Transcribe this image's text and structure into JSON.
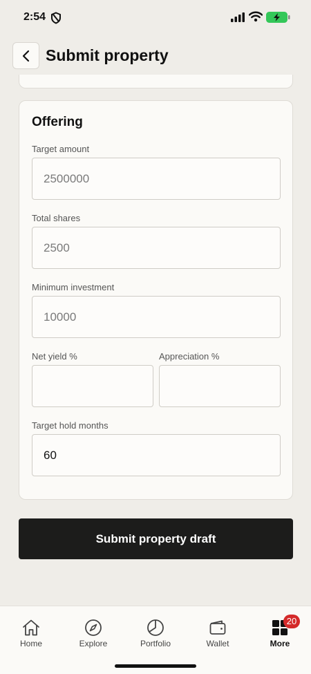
{
  "status_bar": {
    "time": "2:54"
  },
  "header": {
    "title": "Submit property"
  },
  "offering": {
    "title": "Offering",
    "target_amount": {
      "label": "Target amount",
      "placeholder": "2500000",
      "value": ""
    },
    "total_shares": {
      "label": "Total shares",
      "placeholder": "2500",
      "value": ""
    },
    "minimum_investment": {
      "label": "Minimum investment",
      "placeholder": "10000",
      "value": ""
    },
    "net_yield": {
      "label": "Net yield %",
      "placeholder": "",
      "value": ""
    },
    "appreciation": {
      "label": "Appreciation %",
      "placeholder": "",
      "value": ""
    },
    "target_hold_months": {
      "label": "Target hold months",
      "placeholder": "",
      "value": "60"
    }
  },
  "submit_label": "Submit property draft",
  "nav": {
    "items": [
      {
        "label": "Home",
        "icon": "home-icon"
      },
      {
        "label": "Explore",
        "icon": "compass-icon"
      },
      {
        "label": "Portfolio",
        "icon": "pie-chart-icon"
      },
      {
        "label": "Wallet",
        "icon": "wallet-icon"
      },
      {
        "label": "More",
        "icon": "grid-icon",
        "badge": "20"
      }
    ],
    "active": "More"
  },
  "colors": {
    "accent": "#1c1c1b",
    "badge": "#d42a2a",
    "battery": "#34c759"
  }
}
